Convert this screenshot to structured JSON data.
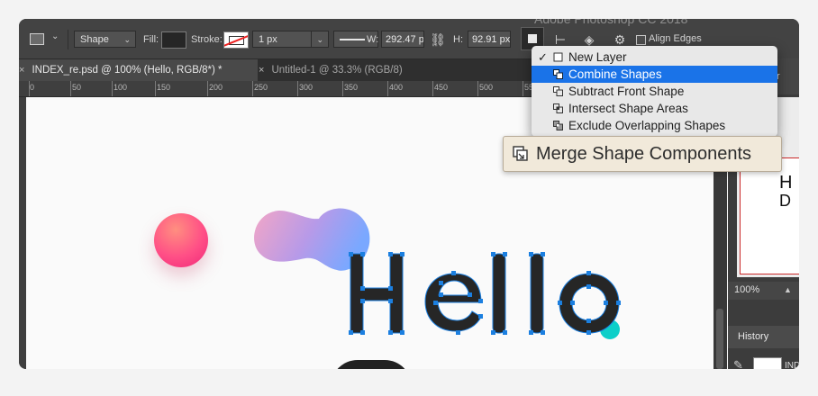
{
  "app": {
    "ghost_title": "Adobe Photoshop CC 2018"
  },
  "options_bar": {
    "mode_select": "Shape",
    "fill_label": "Fill:",
    "stroke_label": "Stroke:",
    "stroke_width": "1 px",
    "w_label": "W:",
    "w_value": "292.47 px",
    "h_label": "H:",
    "h_value": "92.91 px",
    "align_edges_label": "Align Edges",
    "fill_color": "#262626"
  },
  "tabs": [
    {
      "label": "INDEX_re.psd @ 100% (Hello, RGB/8*) *",
      "active": true
    },
    {
      "label": "Untitled-1 @ 33.3% (RGB/8)",
      "active": false
    }
  ],
  "ruler": {
    "marks": [
      "0",
      "50",
      "100",
      "150",
      "200",
      "250",
      "300",
      "350",
      "400",
      "450",
      "500",
      "550"
    ]
  },
  "canvas": {
    "headline": "Hello",
    "accent_pink": "#ff4f86",
    "accent_teal": "#0ccfc9",
    "path_color": "#1b7fe0"
  },
  "path_operations_menu": {
    "items": [
      {
        "label": "New Layer",
        "checked": true,
        "icon": "new-layer-icon",
        "selected": false
      },
      {
        "label": "Combine Shapes",
        "checked": false,
        "icon": "combine-shapes-icon",
        "selected": true
      },
      {
        "label": "Subtract Front Shape",
        "checked": false,
        "icon": "subtract-front-shape-icon",
        "selected": false
      },
      {
        "label": "Intersect Shape Areas",
        "checked": false,
        "icon": "intersect-shape-areas-icon",
        "selected": false
      },
      {
        "label": "Exclude Overlapping Shapes",
        "checked": false,
        "icon": "exclude-overlapping-shapes-icon",
        "selected": false
      }
    ],
    "merge_label": "Merge Shape Components",
    "highlight_color": "#1a73e8"
  },
  "right_panel": {
    "tab_label": "r",
    "thumb_h": "H",
    "thumb_d": "D",
    "zoom": "100%",
    "history_title": "History",
    "history_item": "IND"
  }
}
